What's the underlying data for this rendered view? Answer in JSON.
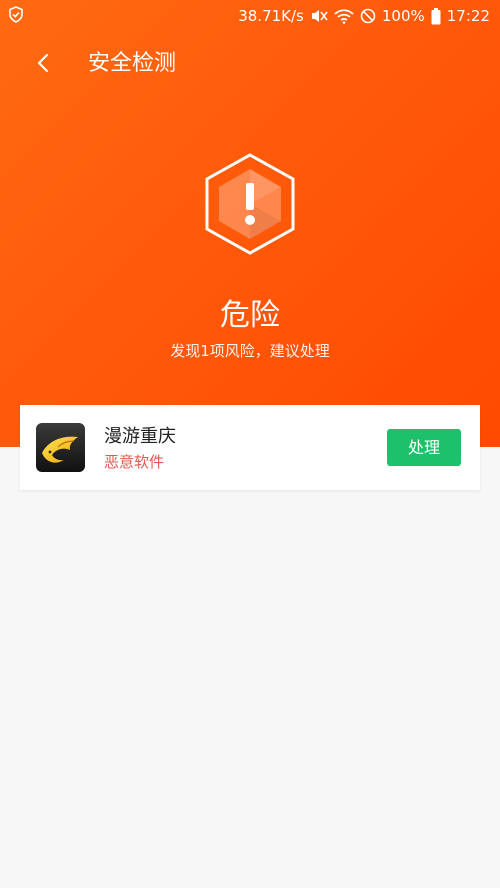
{
  "status_bar": {
    "network_speed": "38.71K/s",
    "battery_percent": "100%",
    "time": "17:22",
    "icons": [
      "shield-icon",
      "mute-icon",
      "wifi-icon",
      "block-icon",
      "battery-icon"
    ]
  },
  "toolbar": {
    "back_icon": "chevron-left-icon",
    "title": "安全检测"
  },
  "result": {
    "icon": "warning-hexagon-icon",
    "title": "危险",
    "subtitle": "发现1项风险，建议处理"
  },
  "risk_items": [
    {
      "app_name": "漫游重庆",
      "risk_label": "恶意软件",
      "action_label": "处理"
    }
  ],
  "colors": {
    "header_gradient_start": "#ff6a12",
    "header_gradient_end": "#ff4a00",
    "risk_text": "#e0594e",
    "action_button": "#1ec16b"
  }
}
